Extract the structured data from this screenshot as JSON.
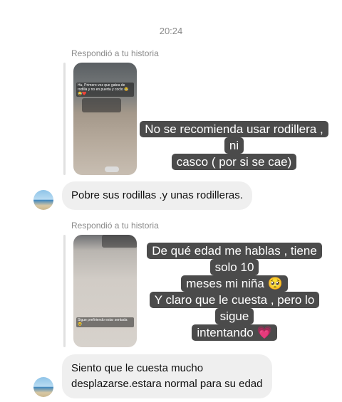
{
  "timestamp": "20:24",
  "messages": [
    {
      "reply_label": "Respondió a tu historia",
      "story_caption": "Hu, Primero vez que gatea de rodilla y no en puerta y coclo 😂😂❤️",
      "overlay_lines": [
        "No se recomienda usar rodillera , ni",
        "casco ( por si se cae)"
      ],
      "reply": "Pobre sus rodillas .y unas rodilleras."
    },
    {
      "reply_label": "Respondió a tu historia",
      "story_caption": "Sigue prefiriendo estar sentada 😂",
      "overlay_lines": [
        "De qué edad me hablas , tiene solo 10",
        "meses mi niña 🥺",
        "Y claro que le cuesta , pero lo sigue",
        "intentando"
      ],
      "overlay_emoji": "💗",
      "reply_lines": [
        "Siento que le cuesta mucho",
        "desplazarse.estara normal para su edad"
      ]
    }
  ]
}
